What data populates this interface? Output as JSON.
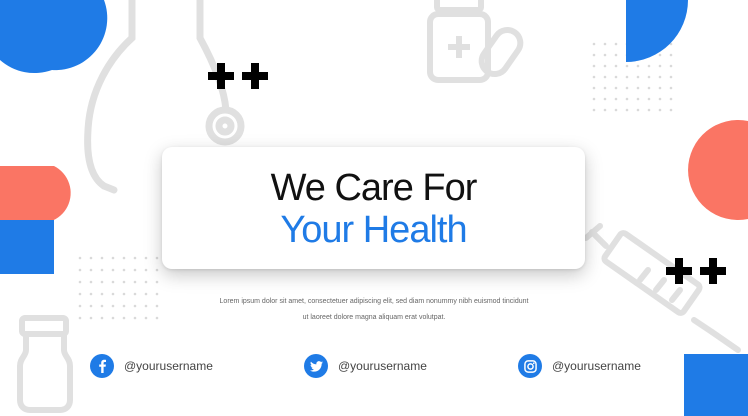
{
  "headline": {
    "line1": "We Care For",
    "line2": "Your Health"
  },
  "body_text": {
    "line1": "Lorem ipsum dolor sit amet, consectetuer adipiscing elit, sed diam nonummy nibh euismod tincidunt",
    "line2": "ut laoreet dolore magna aliquam erat volutpat."
  },
  "social": [
    {
      "network_icon": "facebook-icon",
      "handle": "@yourusername"
    },
    {
      "network_icon": "twitter-icon",
      "handle": "@yourusername"
    },
    {
      "network_icon": "instagram-icon",
      "handle": "@yourusername"
    }
  ],
  "colors": {
    "accent_blue": "#1f7be6",
    "coral": "#fa7564",
    "text_dark": "#111111",
    "outline_gray": "#dedede"
  }
}
